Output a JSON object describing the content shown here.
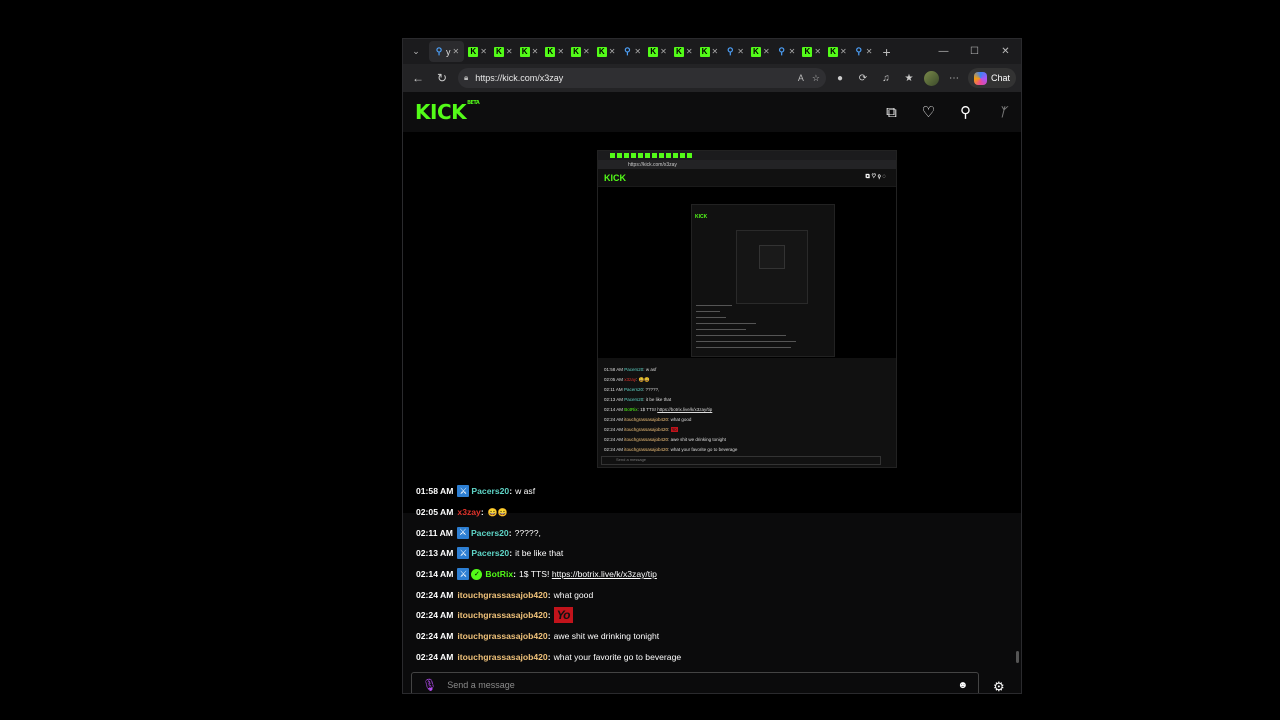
{
  "browser": {
    "active_tab_title": "y",
    "url": "https://kick.com/x3zay",
    "chat_button": "Chat"
  },
  "site": {
    "logo": "KICK",
    "beta": "BETA"
  },
  "colors": {
    "kick_green": "#53fc18",
    "usernames": {
      "Pacers20": "#5fd6c8",
      "x3zay": "#e0332c",
      "BotRix": "#53fc18",
      "itouchgrassasajob420": "#f0c27a"
    }
  },
  "chat": {
    "messages": [
      {
        "time": "01:58 AM",
        "user": "Pacers20",
        "text": "w asf"
      },
      {
        "time": "02:05 AM",
        "user": "x3zay",
        "text": "😄😄"
      },
      {
        "time": "02:11 AM",
        "user": "Pacers20",
        "text": "?????,"
      },
      {
        "time": "02:13 AM",
        "user": "Pacers20",
        "text": "it be like that"
      },
      {
        "time": "02:14 AM",
        "user": "BotRix",
        "text": "1$ TTS!",
        "link": "https://botrix.live/k/x3zay/tip"
      },
      {
        "time": "02:24 AM",
        "user": "itouchgrassasajob420",
        "text": "what good"
      },
      {
        "time": "02:24 AM",
        "user": "itouchgrassasajob420",
        "text": "",
        "emote": "Yo"
      },
      {
        "time": "02:24 AM",
        "user": "itouchgrassasajob420",
        "text": "awe shit we drinking tonight"
      },
      {
        "time": "02:24 AM",
        "user": "itouchgrassasajob420",
        "text": "what your favorite go to beverage"
      }
    ],
    "input_placeholder": "Send a message"
  },
  "icons": {
    "back": "arrow-left-icon",
    "refresh": "refresh-icon",
    "lock": "lock-icon",
    "mic": "microphone-icon",
    "emoji": "emoji-icon",
    "settings": "gear-icon"
  }
}
